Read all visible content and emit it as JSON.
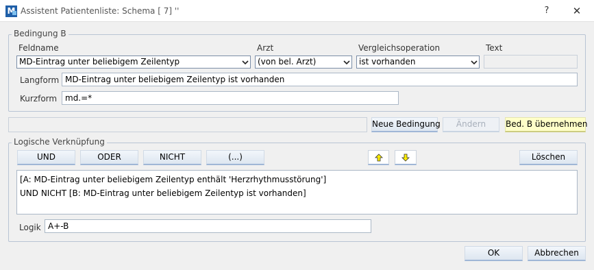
{
  "window": {
    "title": "Assistent Patientenliste: Schema [  7] ''",
    "help": "?",
    "close": "✕"
  },
  "condition_group": {
    "legend": "Bedingung B",
    "fieldname_label": "Feldname",
    "fieldname_value": "MD-Eintrag unter beliebigem Zeilentyp",
    "doctor_label": "Arzt",
    "doctor_value": "(von bel. Arzt)",
    "comparison_label": "Vergleichsoperation",
    "comparison_value": "ist vorhanden",
    "text_label": "Text",
    "text_value": "",
    "langform_label": "Langform",
    "langform_value": "MD-Eintrag unter beliebigem Zeilentyp ist vorhanden",
    "kurzform_label": "Kurzform",
    "kurzform_value": "md.=*"
  },
  "condition_actions": {
    "status_value": "",
    "new_condition": "Neue Bedingung",
    "change": "Ändern",
    "apply": "Bed. B übernehmen"
  },
  "logic_group": {
    "legend": "Logische Verknüpfung",
    "and": "UND",
    "or": "ODER",
    "not": "NICHT",
    "paren": "(...)",
    "delete": "Löschen",
    "expression_lines": [
      "[A: MD-Eintrag unter beliebigem Zeilentyp enthält 'Herzrhythmusstörung']",
      "UND NICHT [B: MD-Eintrag unter beliebigem Zeilentyp ist vorhanden]"
    ],
    "logic_label": "Logik",
    "logic_value": "A+-B"
  },
  "footer": {
    "ok": "OK",
    "cancel": "Abbrechen"
  },
  "icons": {
    "arrow_up": "yellow-arrow-up-icon",
    "arrow_down": "yellow-arrow-down-icon",
    "dropdown": "chevron-down-icon"
  }
}
